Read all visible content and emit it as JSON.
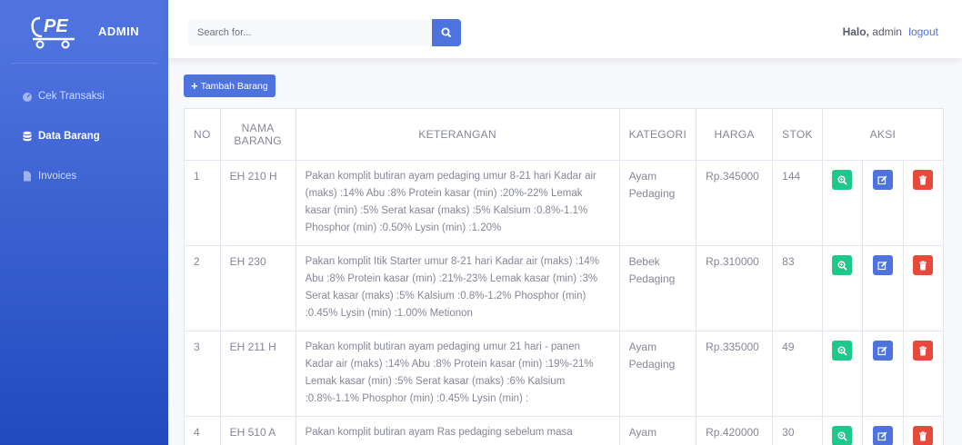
{
  "sidebar": {
    "brand": "ADMIN",
    "logo_text": "PE",
    "items": [
      {
        "label": "Cek Transaksi",
        "active": false,
        "icon": "dashboard-icon"
      },
      {
        "label": "Data Barang",
        "active": true,
        "icon": "database-icon"
      },
      {
        "label": "Invoices",
        "active": false,
        "icon": "file-icon"
      }
    ]
  },
  "topbar": {
    "search_placeholder": "Search for...",
    "greeting": "Halo,",
    "username": "admin",
    "logout": "logout"
  },
  "main": {
    "add_button": "Tambah Barang",
    "table": {
      "headers": {
        "no": "NO",
        "nama_line1": "NAMA",
        "nama_line2": "BARANG",
        "keterangan": "KETERANGAN",
        "kategori": "KATEGORI",
        "harga": "HARGA",
        "stok": "STOK",
        "aksi": "AKSI"
      },
      "rows": [
        {
          "no": "1",
          "nama": "EH 210 H",
          "keterangan": "Pakan komplit butiran ayam pedaging umur 8-21 hari Kadar air (maks) :14% Abu :8% Protein kasar (min) :20%-22% Lemak kasar (min) :5% Serat kasar (maks) :5% Kalsium :0.8%-1.1% Phosphor (min) :0.50% Lysin (min) :1.20%",
          "kategori": "Ayam Pedaging",
          "harga": "Rp.345000",
          "stok": "144"
        },
        {
          "no": "2",
          "nama": "EH 230",
          "keterangan": "Pakan komplit Itik Starter umur 8-21 hari Kadar air (maks) :14% Abu :8% Protein kasar (min) :21%-23% Lemak kasar (min) :3% Serat kasar (maks) :5% Kalsium :0.8%-1.2% Phosphor (min) :0.45% Lysin (min) :1.00% Metionon",
          "kategori": "Bebek Pedaging",
          "harga": "Rp.310000",
          "stok": "83"
        },
        {
          "no": "3",
          "nama": "EH 211 H",
          "keterangan": "Pakan komplit butiran ayam pedaging umur 21 hari - panen Kadar air (maks) :14% Abu :8% Protein kasar (min) :19%-21% Lemak kasar (min) :5% Serat kasar (maks) :6% Kalsium :0.8%-1.1% Phosphor (min) :0.45% Lysin (min) :",
          "kategori": "Ayam Pedaging",
          "harga": "Rp.335000",
          "stok": "49"
        },
        {
          "no": "4",
          "nama": "EH 510 A",
          "keterangan": "Pakan komplit butiran ayam Ras pedaging sebelum masa",
          "kategori": "Ayam",
          "harga": "Rp.420000",
          "stok": "30"
        }
      ]
    }
  },
  "colors": {
    "primary": "#4e73df",
    "success": "#1cc88a",
    "danger": "#e74a3b"
  }
}
